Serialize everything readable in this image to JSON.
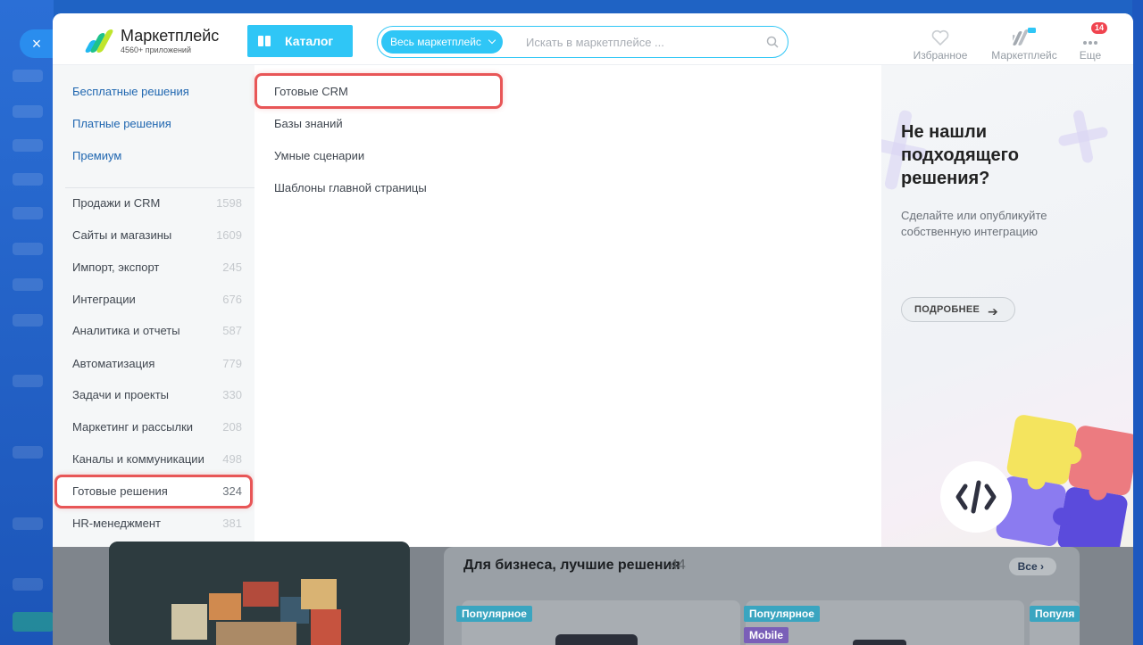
{
  "close_label": "×",
  "header": {
    "logo_title": "Маркетплейс",
    "logo_subtitle": "4560+ приложений",
    "catalog_label": "Каталог",
    "search_scope": "Весь маркетплейс",
    "search_placeholder": "Искать в маркетплейсе ...",
    "favorites_label": "Избранное",
    "marketplace_label": "Маркетплейс",
    "more_label": "Еще",
    "more_badge": "14"
  },
  "sidebar": {
    "top_links": [
      "Бесплатные решения",
      "Платные решения",
      "Премиум"
    ],
    "categories": [
      {
        "label": "Продажи и CRM",
        "count": "1598"
      },
      {
        "label": "Сайты и магазины",
        "count": "1609"
      },
      {
        "label": "Импорт, экспорт",
        "count": "245"
      },
      {
        "label": "Интеграции",
        "count": "676"
      },
      {
        "label": "Аналитика и отчеты",
        "count": "587"
      },
      {
        "label": "Автоматизация",
        "count": "779"
      },
      {
        "label": "Задачи и проекты",
        "count": "330"
      },
      {
        "label": "Маркетинг и рассылки",
        "count": "208"
      },
      {
        "label": "Каналы и коммуникации",
        "count": "498"
      },
      {
        "label": "Готовые решения",
        "count": "324"
      },
      {
        "label": "HR-менеджмент",
        "count": "381"
      }
    ]
  },
  "subcategories": [
    "Готовые CRM",
    "Базы знаний",
    "Умные сценарии",
    "Шаблоны главной страницы"
  ],
  "promo": {
    "title": "Не нашли подходящего решения?",
    "text": "Сделайте или опубликуйте собственную интеграцию",
    "button": "ПОДРОБНЕЕ"
  },
  "bottom": {
    "section_title": "Для бизнеса, лучшие решения",
    "section_count": "44",
    "all_label": "Все",
    "tags": [
      "Популярное",
      "Популярное",
      "Mobile",
      "Популя"
    ]
  },
  "colors": {
    "accent": "#2fc6f6",
    "link": "#2067b0",
    "highlight": "#e85657",
    "badge": "#f0444f"
  }
}
